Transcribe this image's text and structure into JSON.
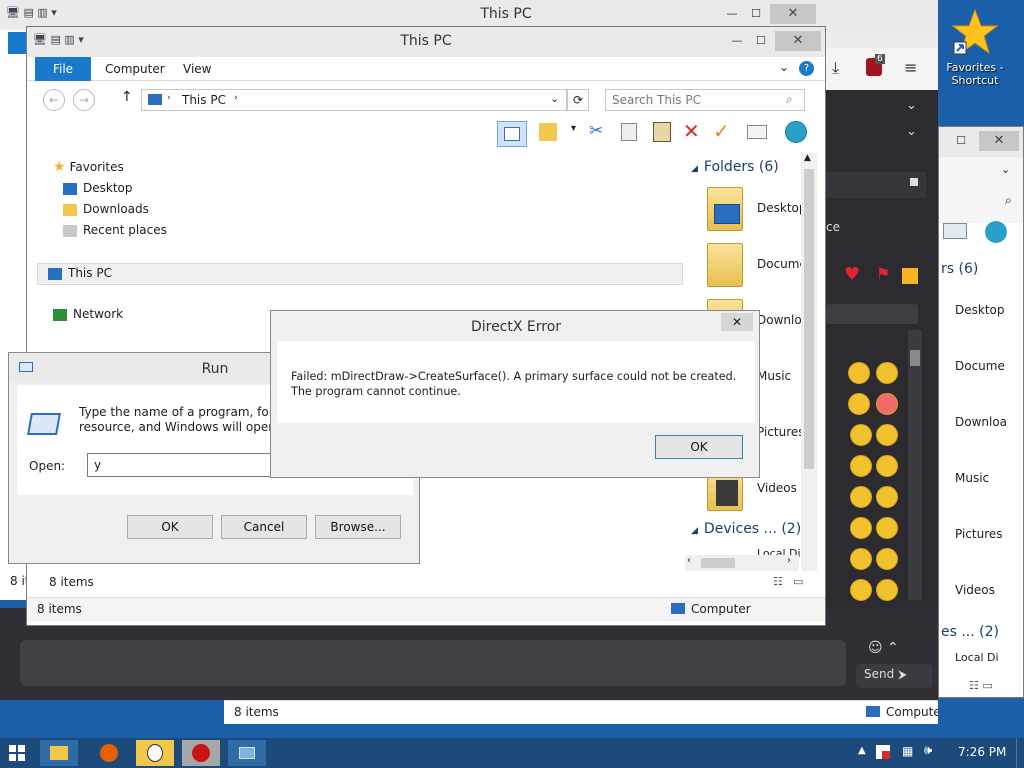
{
  "back_window": {
    "title": "This PC",
    "right_panel_items": [
      "Desktop",
      "Docume",
      "Downloa",
      "Music",
      "Pictures",
      "Videos"
    ],
    "right_panel_folders_header": "rs (6)",
    "right_panel_devices_header": "es ... (2)",
    "right_panel_local_disk": "Local Di",
    "status_items": "8 items",
    "status_computer": "Computer"
  },
  "left_back_window": {
    "status_items": "8 it"
  },
  "browser": {
    "badge": "6",
    "fragment_text": "ce",
    "send_label": "Send"
  },
  "explorer": {
    "title": "This PC",
    "ribbon_tabs": [
      "File",
      "Computer",
      "View"
    ],
    "address": "This PC",
    "search_placeholder": "Search This PC",
    "tree": {
      "favorites": "Favorites",
      "desktop": "Desktop",
      "downloads": "Downloads",
      "recent": "Recent places",
      "this_pc": "This PC",
      "network": "Network"
    },
    "folders_header": "Folders (6)",
    "folders": [
      "Desktop",
      "Docume",
      "Downloa",
      "Music",
      "Pictures",
      "Videos"
    ],
    "devices_header": "Devices ... (2)",
    "local_disk": "Local Di",
    "status_items": "8 items",
    "status_computer": "Computer"
  },
  "run_dialog": {
    "title": "Run",
    "description_line1": "Type the name of a program, folder,",
    "description_line2": "resource, and Windows will open it f",
    "open_label": "Open:",
    "open_value": "y",
    "ok": "OK",
    "cancel": "Cancel",
    "browse": "Browse..."
  },
  "directx_error": {
    "title": "DirectX Error",
    "message_line1": "Failed: mDirectDraw->CreateSurface().  A primary surface could not be created.",
    "message_line2": "The program cannot continue.",
    "ok": "OK"
  },
  "desktop_icon": {
    "label_line1": "Favorites -",
    "label_line2": "Shortcut"
  },
  "taskbar": {
    "time": "7:26 PM"
  },
  "colors": {
    "ribbon_file_tab": "#1979ca",
    "desktop_bg": "#1b5fa8",
    "taskbar": "#1c4a7a",
    "dark_panel": "#2b2b30"
  }
}
